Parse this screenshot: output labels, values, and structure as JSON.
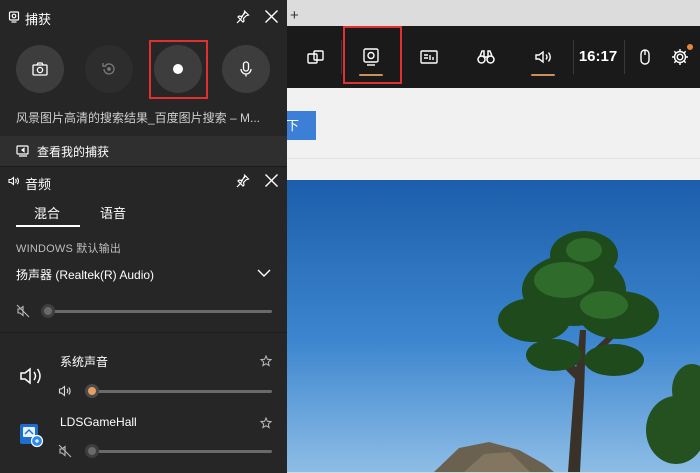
{
  "browser": {
    "new_tab": "+",
    "search_button_text": "下"
  },
  "gamebar": {
    "clock": "16:17",
    "buttons": [
      {
        "name": "widget-menu",
        "icon": "widget-menu-icon"
      },
      {
        "name": "capture",
        "icon": "webcam-capture-icon",
        "active": true
      },
      {
        "name": "performance",
        "icon": "performance-icon"
      },
      {
        "name": "looking-for-group",
        "icon": "binoculars-icon"
      },
      {
        "name": "audio",
        "icon": "speaker-icon",
        "active": true
      },
      {
        "name": "mouse",
        "icon": "mouse-icon"
      },
      {
        "name": "settings",
        "icon": "gear-icon"
      }
    ],
    "accent": "#c8905b"
  },
  "capture_panel": {
    "title": "捕获",
    "game_name": "风景图片高清的搜索结果_百度图片搜索 – M...",
    "show_captures": "查看我的捕获",
    "buttons": [
      "screenshot-icon",
      "record-last-icon",
      "record-icon",
      "microphone-icon"
    ]
  },
  "audio_panel": {
    "title": "音频",
    "tabs": [
      "混合",
      "语音"
    ],
    "section_label": "WINDOWS 默认输出",
    "device_name": "扬声器 (Realtek(R) Audio)",
    "apps": [
      {
        "name": "系统声音",
        "icon": "speaker-icon",
        "volume": 0
      },
      {
        "name": "LDSGameHall",
        "icon": "game-hall-icon",
        "volume": 0
      }
    ],
    "master_volume": 0,
    "highlight_color": "#e03030"
  }
}
